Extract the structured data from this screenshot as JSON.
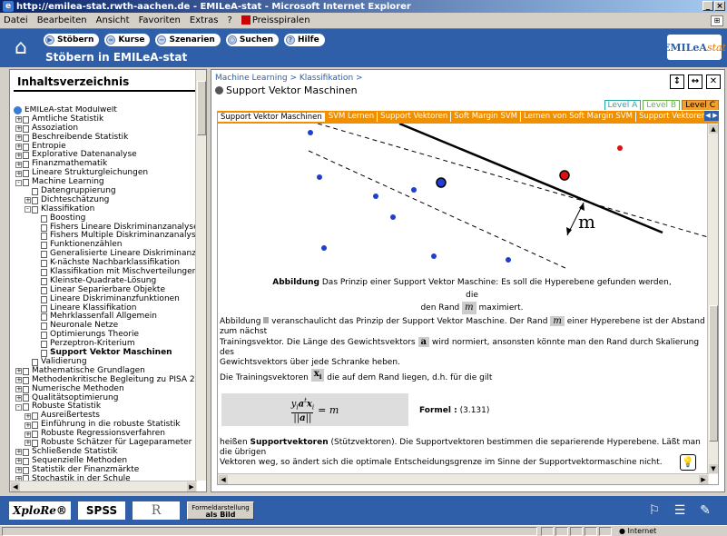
{
  "window": {
    "title": "http://emilea-stat.rwth-aachen.de - EMILeA-stat - Microsoft Internet Explorer",
    "controls": [
      "_",
      "×"
    ]
  },
  "menu": {
    "items": [
      "Datei",
      "Bearbeiten",
      "Ansicht",
      "Favoriten",
      "Extras",
      "?"
    ],
    "favorite": "Preisspiralen"
  },
  "app": {
    "nav": [
      {
        "label": "Stöbern",
        "icon": "play-icon"
      },
      {
        "label": "Kurse",
        "icon": "glasses-icon"
      },
      {
        "label": "Szenarien",
        "icon": "minus-icon"
      },
      {
        "label": "Suchen",
        "icon": "search-icon"
      },
      {
        "label": "Hilfe",
        "icon": "help-icon"
      }
    ],
    "title": "Stöbern in EMILeA-stat",
    "logo_main": "EMILeA",
    "logo_accent": "stat"
  },
  "sidebar": {
    "title": "Inhaltsverzeichnis",
    "tree": [
      {
        "label": "EMILeA-stat Modulwelt",
        "level": 0,
        "type": "root"
      },
      {
        "label": "Amtliche Statistik",
        "level": 1,
        "type": "folder",
        "pm": "+"
      },
      {
        "label": "Assoziation",
        "level": 1,
        "type": "folder",
        "pm": "+"
      },
      {
        "label": "Beschreibende Statistik",
        "level": 1,
        "type": "folder",
        "pm": "+"
      },
      {
        "label": "Entropie",
        "level": 1,
        "type": "folder",
        "pm": "+"
      },
      {
        "label": "Explorative Datenanalyse",
        "level": 1,
        "type": "folder",
        "pm": "+"
      },
      {
        "label": "Finanzmathematik",
        "level": 1,
        "type": "folder",
        "pm": "+"
      },
      {
        "label": "Lineare Strukturgleichungen",
        "level": 1,
        "type": "folder",
        "pm": "+"
      },
      {
        "label": "Machine Learning",
        "level": 1,
        "type": "folder",
        "pm": "-"
      },
      {
        "label": "Datengruppierung",
        "level": 2,
        "type": "doc",
        "pm": ""
      },
      {
        "label": "Dichteschätzung",
        "level": 2,
        "type": "folder",
        "pm": "+"
      },
      {
        "label": "Klassifikation",
        "level": 2,
        "type": "folder",
        "pm": "-"
      },
      {
        "label": "Boosting",
        "level": 3,
        "type": "doc",
        "pm": ""
      },
      {
        "label": "Fishers Lineare Diskriminanzanalyse",
        "level": 3,
        "type": "doc",
        "pm": ""
      },
      {
        "label": "Fishers Multiple Diskriminanzanalyse",
        "level": 3,
        "type": "doc",
        "pm": ""
      },
      {
        "label": "Funktionenzählen",
        "level": 3,
        "type": "doc",
        "pm": ""
      },
      {
        "label": "Generalisierte Lineare Diskriminanzfunktio",
        "level": 3,
        "type": "doc",
        "pm": ""
      },
      {
        "label": "K-nächste Nachbarklassifikation",
        "level": 3,
        "type": "doc",
        "pm": ""
      },
      {
        "label": "Klassifikation mit Mischverteilungen",
        "level": 3,
        "type": "doc",
        "pm": ""
      },
      {
        "label": "Kleinste-Quadrate-Lösung",
        "level": 3,
        "type": "doc",
        "pm": ""
      },
      {
        "label": "Linear Separierbare Objekte",
        "level": 3,
        "type": "doc",
        "pm": ""
      },
      {
        "label": "Lineare Diskriminanzfunktionen",
        "level": 3,
        "type": "doc",
        "pm": ""
      },
      {
        "label": "Lineare Klassifikation",
        "level": 3,
        "type": "doc",
        "pm": ""
      },
      {
        "label": "Mehrklassenfall Allgemein",
        "level": 3,
        "type": "doc",
        "pm": ""
      },
      {
        "label": "Neuronale Netze",
        "level": 3,
        "type": "doc",
        "pm": ""
      },
      {
        "label": "Optimierungs Theorie",
        "level": 3,
        "type": "doc",
        "pm": ""
      },
      {
        "label": "Perzeptron-Kriterium",
        "level": 3,
        "type": "doc",
        "pm": ""
      },
      {
        "label": "Support Vektor Maschinen",
        "level": 3,
        "type": "doc",
        "pm": "",
        "bold": true
      },
      {
        "label": "Validierung",
        "level": 2,
        "type": "doc",
        "pm": ""
      },
      {
        "label": "Mathematische Grundlagen",
        "level": 1,
        "type": "folder",
        "pm": "+"
      },
      {
        "label": "Methodenkritische Begleitung zu PISA 2000",
        "level": 1,
        "type": "folder",
        "pm": "+"
      },
      {
        "label": "Numerische Methoden",
        "level": 1,
        "type": "folder",
        "pm": "+"
      },
      {
        "label": "Qualitätsoptimierung",
        "level": 1,
        "type": "folder",
        "pm": "+"
      },
      {
        "label": "Robuste Statistik",
        "level": 1,
        "type": "folder",
        "pm": "-"
      },
      {
        "label": "Ausreißertests",
        "level": 2,
        "type": "folder",
        "pm": "+"
      },
      {
        "label": "Einführung in die robuste Statistik",
        "level": 2,
        "type": "folder",
        "pm": "+"
      },
      {
        "label": "Robuste Regressionsverfahren",
        "level": 2,
        "type": "folder",
        "pm": "+"
      },
      {
        "label": "Robuste Schätzer für Lageparameter",
        "level": 2,
        "type": "folder",
        "pm": "+"
      },
      {
        "label": "Schließende Statistik",
        "level": 1,
        "type": "folder",
        "pm": "+"
      },
      {
        "label": "Sequenzielle Methoden",
        "level": 1,
        "type": "folder",
        "pm": "+"
      },
      {
        "label": "Statistik der Finanzmärkte",
        "level": 1,
        "type": "folder",
        "pm": "+"
      },
      {
        "label": "Stochastik in der Schule",
        "level": 1,
        "type": "folder",
        "pm": "+"
      }
    ]
  },
  "main": {
    "breadcrumb": "Machine Learning > Klassifikation >",
    "title": "Support Vektor Maschinen",
    "tools": [
      "↕",
      "↔",
      "✕"
    ],
    "levels": [
      "Level A",
      "Level B",
      "Level C"
    ],
    "tabs": [
      "Support Vektor Maschinen",
      "SVM Lernen",
      "Support Vektoren",
      "Soft Margin SVM",
      "Lernen von Soft Margin SVM",
      "Support Vektoren Soft"
    ],
    "figure": {
      "margin_label": "m"
    },
    "caption_bold": "Abbildung",
    "caption_text_1": "Das Prinzip einer Support Vektor Maschine: Es soll die Hyperebene gefunden werden, die",
    "caption_text_2": "den Rand",
    "caption_math": "m",
    "caption_text_3": "maximiert.",
    "para1_a": "Abbildung",
    "para1_b": "veranschaulicht das Prinzip der Support Vektor Maschine. Der Rand",
    "para1_math": "m",
    "para1_c": "einer Hyperebene ist der Abstand zum nächst",
    "para1_d": "Trainingsvektor. Die Länge des Gewichtsvektors",
    "para1_vec": "a",
    "para1_e": "wird normiert, ansonsten könnte man den Rand durch Skalierung des",
    "para1_f": "Gewichtsvektors über jede Schranke heben.",
    "para2_a": "Die Trainingsvektoren",
    "para2_vec": "x",
    "para2_sub": "i",
    "para2_b": "die auf dem Rand liegen, d.h. für die gilt",
    "formula_label": "Formel :",
    "formula_num": "(3.131)",
    "para3_a": "heißen",
    "para3_bold": "Supportvektoren",
    "para3_b": "(Stützvektoren). Die Supportvektoren bestimmen die separierende Hyperebene. Läßt man die übrigen",
    "para3_c": "Vektoren weg, so ändert sich die optimale Entscheidungsgrenze im Sinne der Supportvektormaschine nicht."
  },
  "bottom": {
    "xplore": "XploRe®",
    "spss": "SPSS",
    "r": "R",
    "formel_1": "Formeldarstellung",
    "formel_2": "als Bild"
  },
  "status": {
    "zone": "Internet"
  },
  "colors": {
    "brand_blue": "#2e5fa8",
    "tab_orange": "#f09000",
    "class_blue": "#1f3fd1",
    "class_red": "#e01010"
  }
}
